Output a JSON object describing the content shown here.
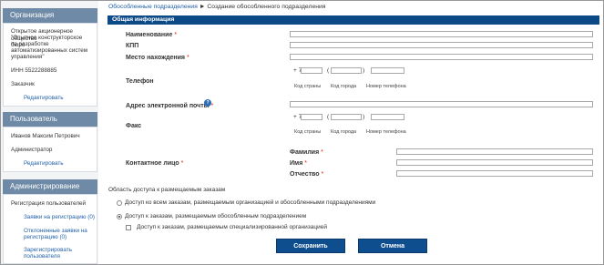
{
  "breadcrumb": {
    "link": "Обособленные подразделения",
    "current": "Создание обособленного подразделения"
  },
  "sidebar": {
    "org": {
      "title": "Организация",
      "name_lines": [
        "Открытое акционерное общество",
        "\"Опытное конструкторское бюро",
        "по разработке",
        "автоматизированных систем",
        "управления\""
      ],
      "inn": "ИНН 5522288885",
      "role": "Заказчик",
      "edit": "Редактировать"
    },
    "user": {
      "title": "Пользователь",
      "name": "Иванов Максим Петрович",
      "role": "Администратор",
      "edit": "Редактировать"
    },
    "admin": {
      "title": "Администрирование",
      "items": [
        "Регистрация пользователей",
        "Заявки на регистрацию (0)",
        "Отклоненные заявки на",
        "регистрацию (0)",
        "Зарегистрировать",
        "пользователя"
      ]
    }
  },
  "form": {
    "section": "Общая информация",
    "name_label": "Наименование",
    "kpp_label": "КПП",
    "location_label": "Место нахождения",
    "phone_label": "Телефон",
    "phone_prefix": "+ 7",
    "phone_hints": {
      "country": "Код страны",
      "city": "Код города",
      "number": "Номер телефона"
    },
    "email_label": "Адрес электронной почты",
    "fax_label": "Факс",
    "contact_label": "Контактное лицо",
    "last_name": "Фамилия",
    "first_name": "Имя",
    "patronymic": "Отчество",
    "access_title": "Область доступа к размещаемым заказам",
    "access_option_all": "Доступ ко всем заказам, размещаемым организацией и обособленными подразделениями",
    "access_option_own": "Доступ к заказам, размещаемым обособленным подразделением",
    "access_option_spec": "Доступ к заказам, размещаемым специализированной организацией",
    "req_mark": "*",
    "help": "?"
  },
  "buttons": {
    "save": "Сохранить",
    "cancel": "Отмена"
  },
  "colors": {
    "header_blue": "#0c4a87",
    "panel_header": "#6f8aa6",
    "link": "#1f5fa8",
    "required": "#dd2211"
  }
}
